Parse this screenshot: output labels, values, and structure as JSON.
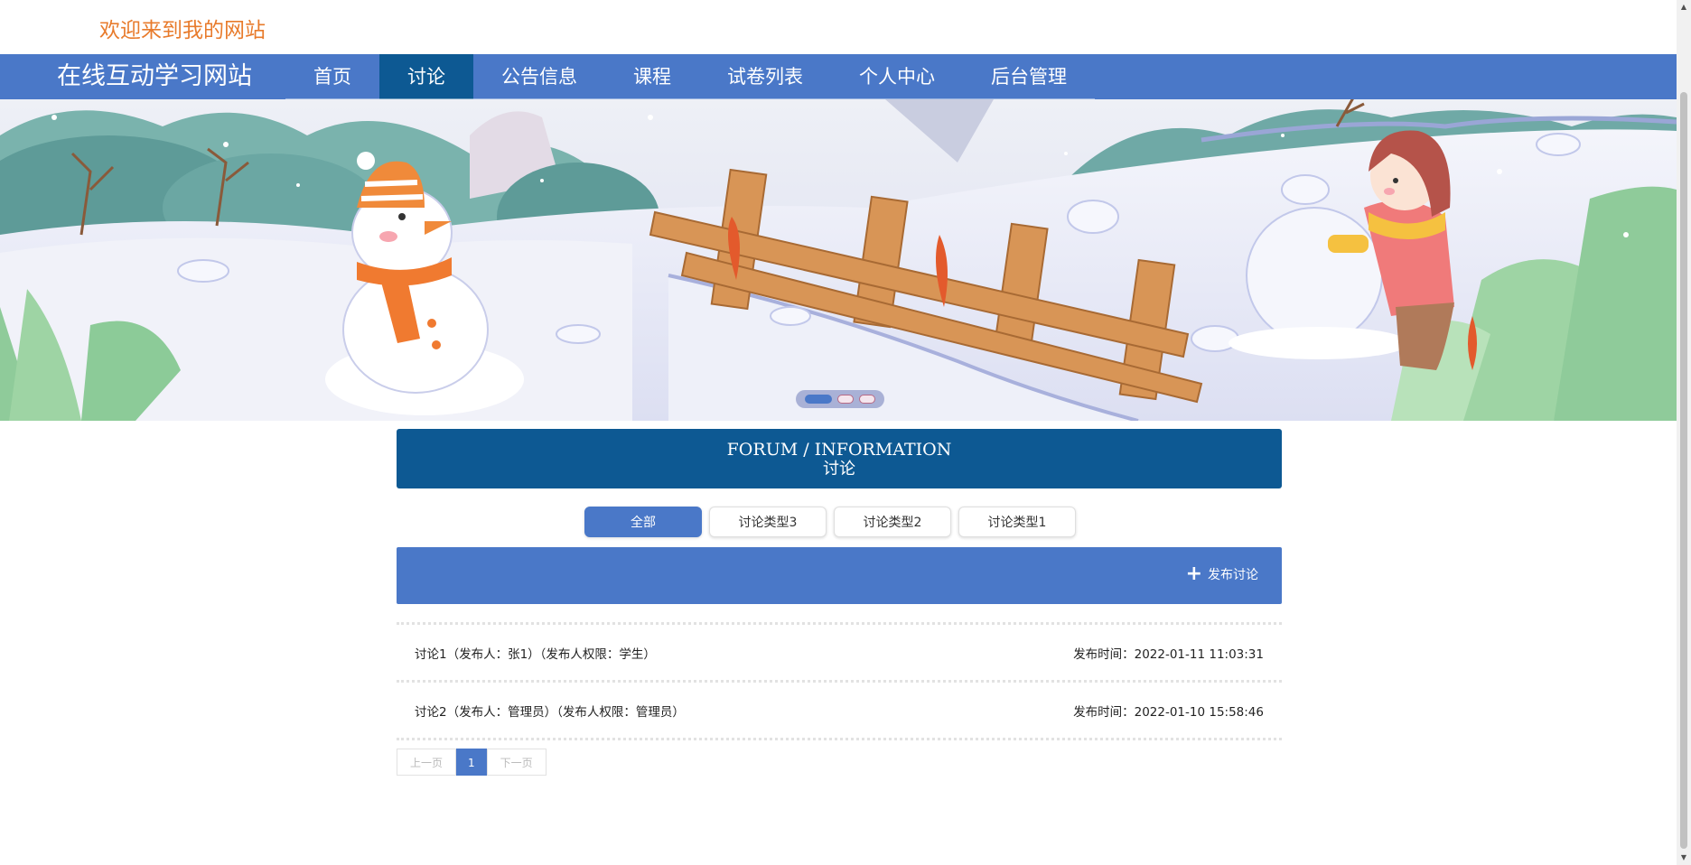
{
  "header": {
    "greeting": "欢迎来到我的网站"
  },
  "nav": {
    "brand": "在线互动学习网站",
    "items": [
      {
        "label": "首页"
      },
      {
        "label": "讨论",
        "active": true
      },
      {
        "label": "公告信息"
      },
      {
        "label": "课程"
      },
      {
        "label": "试卷列表"
      },
      {
        "label": "个人中心"
      },
      {
        "label": "后台管理"
      }
    ]
  },
  "banner": {
    "slides": 3,
    "active_slide": 1
  },
  "forum": {
    "title_en": "FORUM / INFORMATION",
    "title_cn": "讨论"
  },
  "tabs": [
    {
      "label": "全部",
      "active": true
    },
    {
      "label": "讨论类型3"
    },
    {
      "label": "讨论类型2"
    },
    {
      "label": "讨论类型1"
    }
  ],
  "publish": {
    "icon": "plus-icon",
    "label": "发布讨论"
  },
  "posts": [
    {
      "title": "讨论1（发布人：张1）（发布人权限：学生）",
      "time": "发布时间：2022-01-11 11:03:31"
    },
    {
      "title": "讨论2（发布人：管理员）（发布人权限：管理员）",
      "time": "发布时间：2022-01-10 15:58:46"
    }
  ],
  "pagination": {
    "prev": "上一页",
    "current": "1",
    "next": "下一页"
  },
  "colors": {
    "accent": "#4a78c8",
    "dark_accent": "#0d5993",
    "greeting": "#e87b2c"
  }
}
